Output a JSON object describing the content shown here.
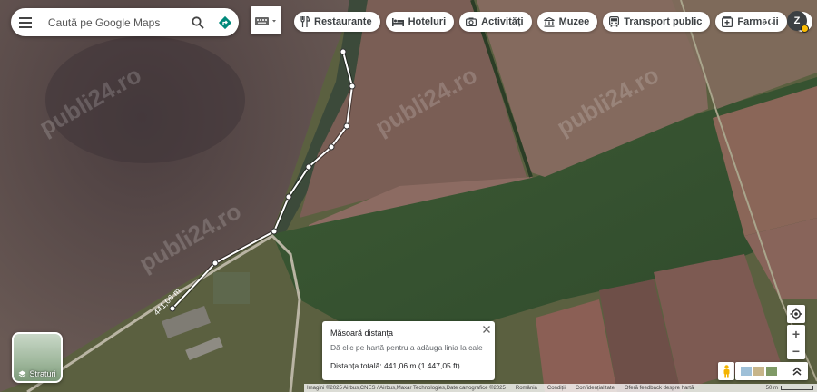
{
  "search": {
    "placeholder": "Caută pe Google Maps"
  },
  "icons": {
    "menu": "menu-icon",
    "search": "search-icon",
    "directions": "directions-icon",
    "keyboard": "keyboard-icon",
    "apps": "apps-grid-icon",
    "layers": "layers-icon",
    "close": "close-icon",
    "location": "my-location-icon",
    "pegman": "pegman-icon",
    "expand": "chevrons-up-icon"
  },
  "categories": [
    {
      "label": "Restaurante",
      "icon": "fork-knife-icon"
    },
    {
      "label": "Hoteluri",
      "icon": "bed-icon"
    },
    {
      "label": "Activități",
      "icon": "camera-icon"
    },
    {
      "label": "Muzee",
      "icon": "museum-icon"
    },
    {
      "label": "Transport public",
      "icon": "bus-icon"
    },
    {
      "label": "Farmacii",
      "icon": "pharmacy-icon"
    }
  ],
  "account": {
    "initial": "Z"
  },
  "layers": {
    "label": "Straturi"
  },
  "measure": {
    "title": "Măsoară distanța",
    "hint": "Dă clic pe hartă pentru a adăuga linia la cale",
    "total": "Distanța totală: 441,06 m (1.447,05 ft)",
    "path_label": "441,06 m"
  },
  "watermarks": [
    "publi24.ro",
    "publi24.ro",
    "publi24.ro",
    "publi24.ro"
  ],
  "zoom": {
    "in": "+",
    "out": "−"
  },
  "footer": {
    "attribution": "Imagini ©2025 Airbus,CNES / Airbus,Maxar Technologies,Date cartografice ©2025",
    "country": "România",
    "terms": "Condiții",
    "privacy": "Confidențialitate",
    "feedback": "Oferă feedback despre hartă",
    "scale": "50 m"
  },
  "colors": {
    "accent": "#1a73e8",
    "directions": "#00897b",
    "measure_line": "#ffffff"
  }
}
